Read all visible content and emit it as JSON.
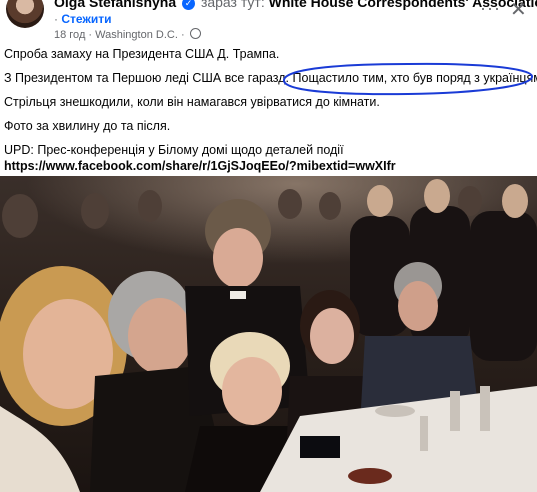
{
  "header": {
    "author": "Olga Stefanishyna",
    "presence": "зараз тут:",
    "place": "White House Correspondents' Association.",
    "follow_label": "Стежити",
    "time": "18 год",
    "location": "Washington D.C.",
    "dot": "·",
    "more_icon": "more-dots-icon",
    "close_icon": "close-icon"
  },
  "post": {
    "line1": "Спроба замаху на Президента США Д. Трампа.",
    "line2": "З Президентом та Першою леді США все гаразд. Пощастило тим, хто був поряд з українцями.",
    "line3": "Стрільця знешкодили, коли він намагався увірватися до кімнати.",
    "line4": "Фото за хвилину до та після.",
    "line5": "UPD: Прес-конференція у Білому домі щодо деталей події",
    "link": "https://www.facebook.com/share/r/1GjSJoqEEo/?mibextid=wwXIfr"
  },
  "colors": {
    "link_blue": "#0866ff",
    "secondary_text": "#65676b",
    "annotation_blue": "#1a3bd6"
  }
}
